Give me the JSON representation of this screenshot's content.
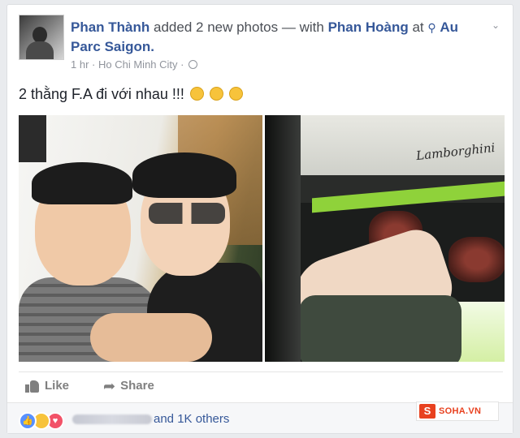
{
  "post": {
    "author": "Phan Thành",
    "action": "added 2 new photos — with",
    "tagged": "Phan Hoàng",
    "at": "at",
    "place": "Au Parc Saigon.",
    "time": "1 hr",
    "separator": "·",
    "location": "Ho Chi Minh City",
    "text": "2 thằng F.A đi với nhau !!!",
    "brand_text": "Lamborghini",
    "icons": {
      "place": "map-pin-icon",
      "privacy": "globe-icon",
      "options": "chevron-down-icon"
    }
  },
  "actions": {
    "like": "Like",
    "share": "Share"
  },
  "reactions": {
    "summary": "and 1K others",
    "types": [
      "like",
      "haha",
      "love"
    ]
  },
  "watermark": {
    "logo": "S",
    "text": "SOHA.VN"
  },
  "colors": {
    "link": "#365899",
    "meta": "#90949c",
    "like_reaction": "#5890ff",
    "love_reaction": "#f25268",
    "haha_reaction": "#f7c33b",
    "watermark": "#e8411f"
  }
}
